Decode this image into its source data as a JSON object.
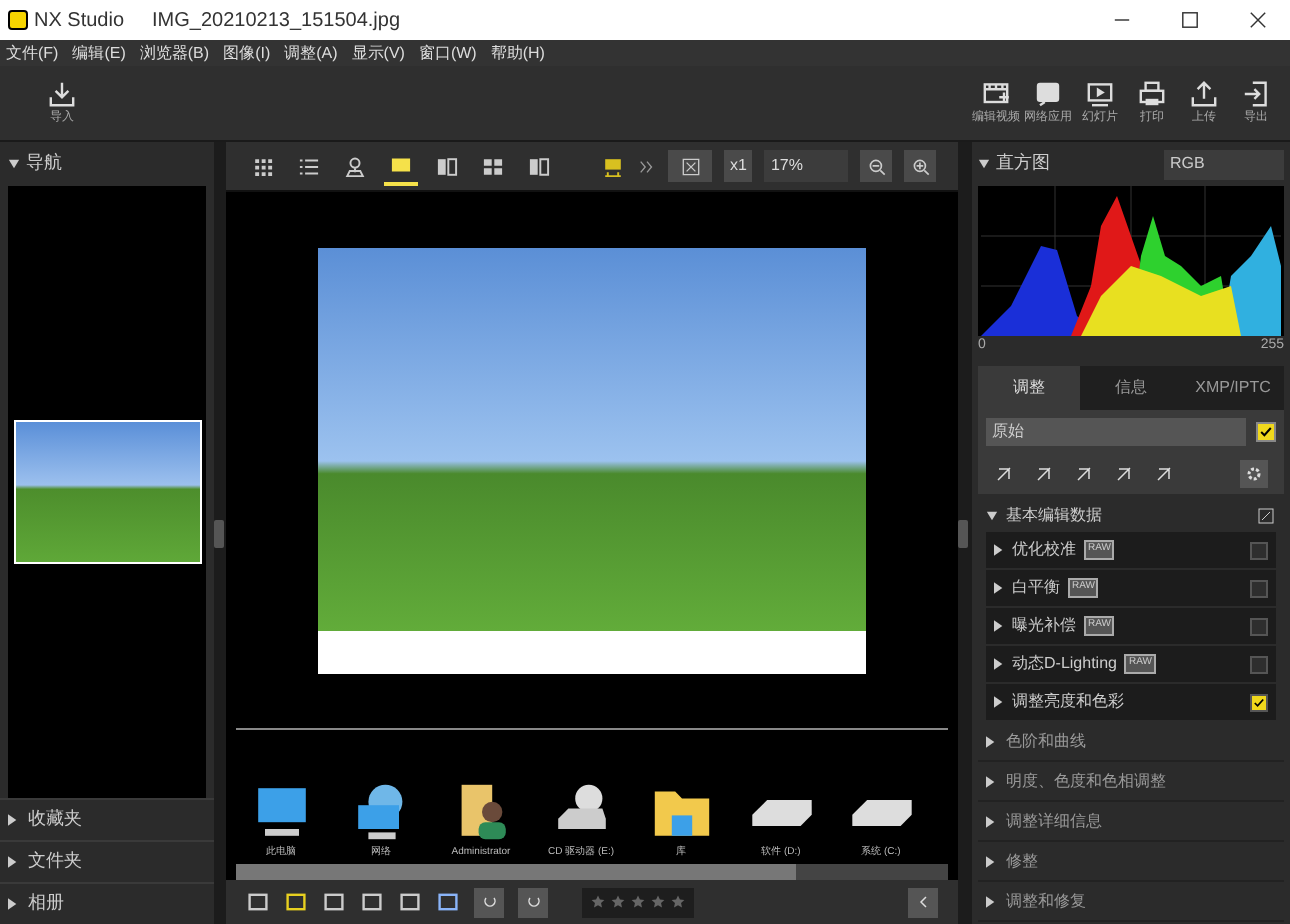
{
  "title_bar": {
    "app": "NX Studio",
    "file": "IMG_20210213_151504.jpg"
  },
  "menu": [
    "文件(F)",
    "编辑(E)",
    "浏览器(B)",
    "图像(I)",
    "调整(A)",
    "显示(V)",
    "窗口(W)",
    "帮助(H)"
  ],
  "toolbar": {
    "left": [
      {
        "label": "导入",
        "kind": "import"
      }
    ],
    "right": [
      {
        "label": "编辑视频",
        "kind": "film"
      },
      {
        "label": "网络应用",
        "kind": "app"
      },
      {
        "label": "幻灯片",
        "kind": "play"
      },
      {
        "label": "打印",
        "kind": "print"
      },
      {
        "label": "上传",
        "kind": "upload"
      },
      {
        "label": "导出",
        "kind": "export"
      }
    ]
  },
  "navigator": {
    "title": "导航",
    "expanded": true
  },
  "left_sections": [
    {
      "label": "收藏夹",
      "expanded": false
    },
    {
      "label": "文件夹",
      "expanded": false
    },
    {
      "label": "相册",
      "expanded": false
    }
  ],
  "view_modes": [
    {
      "kind": "grid",
      "selected": false
    },
    {
      "kind": "list",
      "selected": false
    },
    {
      "kind": "map",
      "selected": false
    },
    {
      "kind": "single",
      "selected": true
    },
    {
      "kind": "compare2",
      "selected": false
    },
    {
      "kind": "compare4",
      "selected": false
    },
    {
      "kind": "split",
      "selected": false
    }
  ],
  "view_options": {
    "scale": "x1",
    "zoom": "17%"
  },
  "filmstrip": [
    {
      "label": "此电脑",
      "kind": "pc"
    },
    {
      "label": "网络",
      "kind": "network"
    },
    {
      "label": "Administrator",
      "kind": "user"
    },
    {
      "label": "CD 驱动器 (E:)",
      "kind": "cd"
    },
    {
      "label": "库",
      "kind": "folder"
    },
    {
      "label": "软件 (D:)",
      "kind": "drive"
    },
    {
      "label": "系统 (C:)",
      "kind": "drive"
    }
  ],
  "rating": {
    "stars": 0
  },
  "histogram": {
    "title": "直方图",
    "channel": "RGB",
    "min": "0",
    "max": "255"
  },
  "tabs": [
    {
      "label": "调整",
      "selected": true
    },
    {
      "label": "信息",
      "selected": false
    },
    {
      "label": "XMP/IPTC",
      "selected": false
    }
  ],
  "preset": {
    "value": "原始",
    "checked": true
  },
  "section": {
    "title": "基本编辑数据",
    "expanded": true,
    "items": [
      {
        "label": "优化校准",
        "badge": "RAW",
        "checked": false
      },
      {
        "label": "白平衡",
        "badge": "RAW",
        "checked": false
      },
      {
        "label": "曝光补偿",
        "badge": "RAW",
        "checked": false
      },
      {
        "label": "动态D-Lighting",
        "badge": "RAW",
        "checked": false
      },
      {
        "label": "调整亮度和色彩",
        "checked": true
      }
    ]
  },
  "collapsed_sections": [
    {
      "label": "色阶和曲线",
      "expanded": false
    },
    {
      "label": "明度、色度和色相调整",
      "expanded": false
    },
    {
      "label": "调整详细信息",
      "expanded": false
    },
    {
      "label": "修整",
      "expanded": false
    },
    {
      "label": "调整和修复",
      "expanded": false
    }
  ]
}
